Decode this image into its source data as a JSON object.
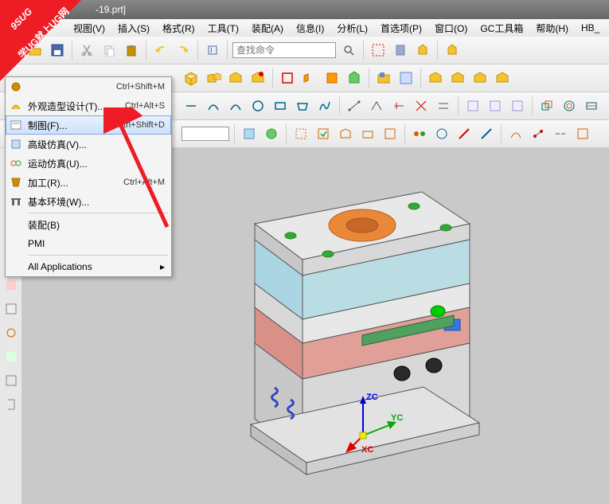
{
  "title": "-19.prt]",
  "menubar": [
    "视图(V)",
    "插入(S)",
    "格式(R)",
    "工具(T)",
    "装配(A)",
    "信息(I)",
    "分析(L)",
    "首选项(P)",
    "窗口(O)",
    "GC工具箱",
    "帮助(H)",
    "HB_"
  ],
  "search_placeholder": "查找命令",
  "context_menu": {
    "items": [
      {
        "label": "",
        "shortcut": "Ctrl+Shift+M",
        "icon": "gear"
      },
      {
        "label": "外观造型设计(T)...",
        "shortcut": "Ctrl+Alt+S",
        "icon": "shape"
      },
      {
        "label": "制图(F)...",
        "shortcut": "Ctrl+Shift+D",
        "icon": "drafting",
        "highlighted": true
      },
      {
        "label": "高级仿真(V)...",
        "shortcut": "",
        "icon": "sim"
      },
      {
        "label": "运动仿真(U)...",
        "shortcut": "",
        "icon": "motion"
      },
      {
        "label": "加工(R)...",
        "shortcut": "Ctrl+Alt+M",
        "icon": "mfg"
      },
      {
        "label": "基本环境(W)...",
        "shortcut": "",
        "icon": "gateway"
      },
      {
        "sep": true
      },
      {
        "label": "装配(B)",
        "shortcut": ""
      },
      {
        "label": "PMI",
        "shortcut": ""
      },
      {
        "sep": true
      },
      {
        "label": "All Applications",
        "shortcut": "",
        "arrow": true
      }
    ]
  },
  "csys": {
    "z": "ZC",
    "y": "YC",
    "x": "XC"
  },
  "watermark": {
    "line1": "9SUG",
    "line2": "学UG就上UG网"
  }
}
